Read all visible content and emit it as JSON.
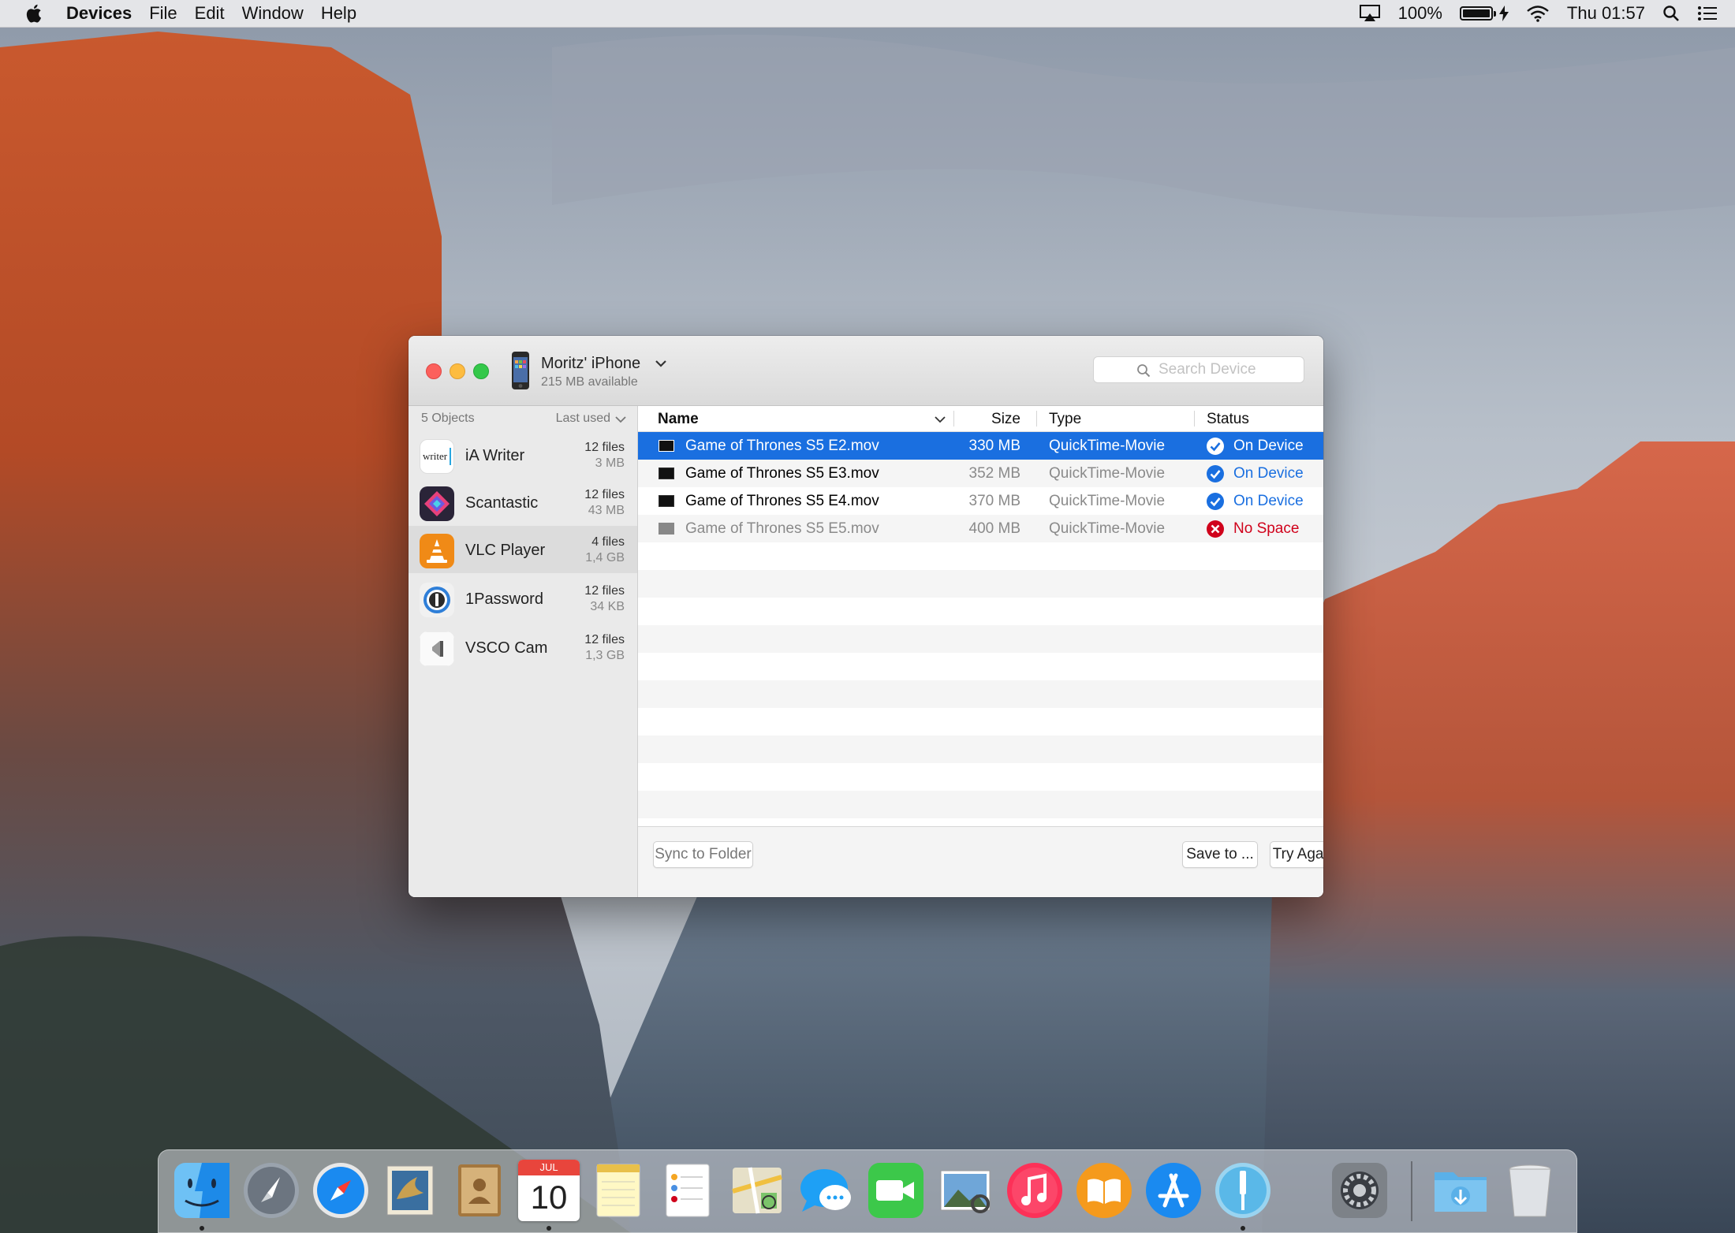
{
  "menubar": {
    "app_name": "Devices",
    "menus": [
      "File",
      "Edit",
      "Window",
      "Help"
    ],
    "battery_percent": "100%",
    "battery_level": 1.0,
    "clock": "Thu 01:57",
    "icons": [
      "apple-icon",
      "airplay-icon",
      "battery-icon",
      "charging-icon",
      "wifi-icon",
      "spotlight-icon",
      "notification-center-icon"
    ]
  },
  "window": {
    "device": {
      "name": "Moritz' iPhone",
      "available": "215 MB available"
    },
    "search": {
      "placeholder": "Search Device"
    },
    "sidebar": {
      "count": "5 Objects",
      "sort": "Last used",
      "items": [
        {
          "name": "iA Writer",
          "files": "12 files",
          "size": "3 MB",
          "icon": "ia-writer-icon",
          "icon_text": "writer",
          "selected": false
        },
        {
          "name": "Scantastic",
          "files": "12 files",
          "size": "43 MB",
          "icon": "scantastic-icon",
          "selected": false
        },
        {
          "name": "VLC Player",
          "files": "4 files",
          "size": "1,4 GB",
          "icon": "vlc-icon",
          "selected": true
        },
        {
          "name": "1Password",
          "files": "12 files",
          "size": "34 KB",
          "icon": "onepassword-icon",
          "selected": false
        },
        {
          "name": "VSCO Cam",
          "files": "12 files",
          "size": "1,3 GB",
          "icon": "vsco-icon",
          "selected": false
        }
      ]
    },
    "table": {
      "columns": {
        "name": "Name",
        "size": "Size",
        "type": "Type",
        "status": "Status"
      },
      "rows": [
        {
          "name": "Game of Thrones S5 E2.mov",
          "size": "330 MB",
          "type": "QuickTime-Movie",
          "status": "On Device",
          "state": "ok",
          "selected": true
        },
        {
          "name": "Game of Thrones S5 E3.mov",
          "size": "352 MB",
          "type": "QuickTime-Movie",
          "status": "On Device",
          "state": "ok",
          "selected": false
        },
        {
          "name": "Game of Thrones S5 E4.mov",
          "size": "370 MB",
          "type": "QuickTime-Movie",
          "status": "On Device",
          "state": "ok",
          "selected": false
        },
        {
          "name": "Game of Thrones S5 E5.mov",
          "size": "400 MB",
          "type": "QuickTime-Movie",
          "status": "No Space",
          "state": "error",
          "selected": false
        }
      ]
    },
    "footer": {
      "sync_label": "Sync to Folder",
      "save_label": "Save to ...",
      "retry_label": "Try Again"
    }
  },
  "colors": {
    "selection_blue": "#1a6fe0",
    "error_red": "#d0021b",
    "close": "#fc605c",
    "minimize": "#fdbc40",
    "zoom": "#34c84a"
  },
  "dock": {
    "calendar_month": "JUL",
    "calendar_day": "10",
    "apps": [
      "finder-icon",
      "launchpad-icon",
      "safari-icon",
      "mail-icon",
      "contacts-icon",
      "calendar-icon",
      "notes-icon",
      "reminders-icon",
      "maps-icon",
      "messages-icon",
      "facetime-icon",
      "photo-preview-icon",
      "itunes-icon",
      "ibooks-icon",
      "app-store-icon",
      "devices-app-icon",
      "system-preferences-icon",
      "downloads-folder-icon",
      "trash-icon"
    ]
  }
}
